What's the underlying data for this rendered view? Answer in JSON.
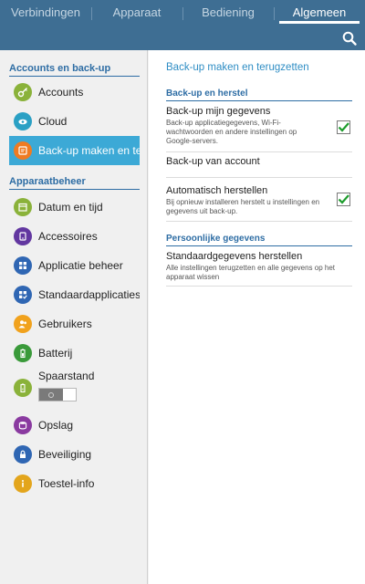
{
  "tabs": [
    {
      "label": "Verbindingen"
    },
    {
      "label": "Apparaat"
    },
    {
      "label": "Bediening"
    },
    {
      "label": "Algemeen"
    }
  ],
  "colors": {
    "accent": "#3e6e93",
    "selected": "#3ca9d6",
    "header": "#2e6da4",
    "check": "#1c9c2c"
  },
  "sidebar": {
    "section1": "Accounts en back-up",
    "section2": "Apparaatbeheer",
    "items": [
      {
        "label": "Accounts",
        "icon": "key-icon",
        "color": "#8ab23a"
      },
      {
        "label": "Cloud",
        "icon": "cloud-icon",
        "color": "#2aa0c4"
      },
      {
        "label": "Back-up maken en terugzetten",
        "icon": "backup-icon",
        "color": "#ef7b22"
      },
      {
        "label": "Datum en tijd",
        "icon": "calendar-icon",
        "color": "#8ab23a"
      },
      {
        "label": "Accessoires",
        "icon": "accessory-icon",
        "color": "#6237a0"
      },
      {
        "label": "Applicatie beheer",
        "icon": "apps-grid-icon",
        "color": "#2f66b3"
      },
      {
        "label": "Standaardapplicaties",
        "icon": "default-apps-icon",
        "color": "#2f66b3"
      },
      {
        "label": "Gebruikers",
        "icon": "users-icon",
        "color": "#f1a21d"
      },
      {
        "label": "Batterij",
        "icon": "battery-icon",
        "color": "#3a9a3a"
      },
      {
        "label": "Spaarstand",
        "icon": "power-saving-icon",
        "color": "#8ab23a"
      },
      {
        "label": "Opslag",
        "icon": "storage-icon",
        "color": "#8a3aa0"
      },
      {
        "label": "Beveiliging",
        "icon": "lock-icon",
        "color": "#2f66b3"
      },
      {
        "label": "Toestel-info",
        "icon": "info-icon",
        "color": "#e3a51c"
      }
    ]
  },
  "main": {
    "title": "Back-up maken en terugzetten",
    "section1": "Back-up en herstel",
    "section2": "Persoonlijke gegevens",
    "backup_data": {
      "title": "Back-up mijn gegevens",
      "subtitle": "Back-up applicatiegegevens, Wi-Fi-wachtwoorden en andere instellingen op Google-servers.",
      "checked": true
    },
    "backup_account": {
      "title": "Back-up van account"
    },
    "auto_restore": {
      "title": "Automatisch herstellen",
      "subtitle": "Bij opnieuw installeren herstelt u instellingen en gegevens uit back-up.",
      "checked": true
    },
    "factory_reset": {
      "title": "Standaardgegevens herstellen",
      "subtitle": "Alle instellingen terugzetten en alle gegevens op het apparaat wissen"
    }
  }
}
